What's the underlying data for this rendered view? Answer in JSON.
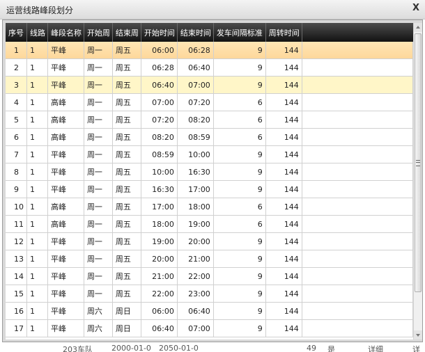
{
  "window": {
    "title": "运营线路峰段划分",
    "close_label": "X"
  },
  "table": {
    "columns": [
      "序号",
      "线路",
      "峰段名称",
      "开始周",
      "结束周",
      "开始时间",
      "结束时间",
      "发车间隔标准",
      "周转时间"
    ],
    "rows": [
      [
        "1",
        "1",
        "平峰",
        "周一",
        "周五",
        "06:00",
        "06:28",
        "9",
        "144"
      ],
      [
        "2",
        "1",
        "平峰",
        "周一",
        "周五",
        "06:28",
        "06:40",
        "9",
        "144"
      ],
      [
        "3",
        "1",
        "平峰",
        "周一",
        "周五",
        "06:40",
        "07:00",
        "9",
        "144"
      ],
      [
        "4",
        "1",
        "高峰",
        "周一",
        "周五",
        "07:00",
        "07:20",
        "6",
        "144"
      ],
      [
        "5",
        "1",
        "高峰",
        "周一",
        "周五",
        "07:20",
        "08:20",
        "6",
        "144"
      ],
      [
        "6",
        "1",
        "高峰",
        "周一",
        "周五",
        "08:20",
        "08:59",
        "6",
        "144"
      ],
      [
        "7",
        "1",
        "平峰",
        "周一",
        "周五",
        "08:59",
        "10:00",
        "9",
        "144"
      ],
      [
        "8",
        "1",
        "平峰",
        "周一",
        "周五",
        "10:00",
        "16:30",
        "9",
        "144"
      ],
      [
        "9",
        "1",
        "平峰",
        "周一",
        "周五",
        "16:30",
        "17:00",
        "9",
        "144"
      ],
      [
        "10",
        "1",
        "高峰",
        "周一",
        "周五",
        "17:00",
        "18:00",
        "6",
        "144"
      ],
      [
        "11",
        "1",
        "高峰",
        "周一",
        "周五",
        "18:00",
        "19:00",
        "6",
        "144"
      ],
      [
        "12",
        "1",
        "平峰",
        "周一",
        "周五",
        "19:00",
        "20:00",
        "9",
        "144"
      ],
      [
        "13",
        "1",
        "平峰",
        "周一",
        "周五",
        "20:00",
        "21:00",
        "9",
        "144"
      ],
      [
        "14",
        "1",
        "平峰",
        "周一",
        "周五",
        "21:00",
        "22:00",
        "9",
        "144"
      ],
      [
        "15",
        "1",
        "平峰",
        "周一",
        "周五",
        "22:00",
        "23:00",
        "9",
        "144"
      ],
      [
        "16",
        "1",
        "平峰",
        "周六",
        "周日",
        "06:00",
        "06:40",
        "9",
        "144"
      ],
      [
        "17",
        "1",
        "平峰",
        "周六",
        "周日",
        "06:40",
        "07:00",
        "9",
        "144"
      ]
    ],
    "selected_row": "1",
    "hover_row": "3"
  },
  "background_strip": {
    "items": [
      "203车队",
      "2000-01-0",
      "2050-01-0",
      "49",
      "是",
      "详细",
      "详细"
    ]
  },
  "colors": {
    "header_bg": "#1e1e1e",
    "selected_row": "#fdd79a",
    "hover_row": "#fff6c8"
  }
}
